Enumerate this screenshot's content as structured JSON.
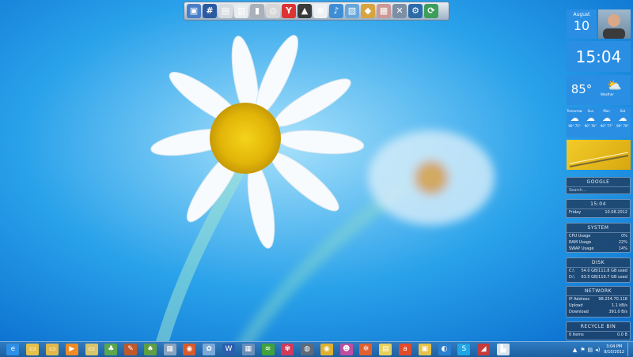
{
  "dock": {
    "items": [
      {
        "icon": "monitor-icon",
        "color": "#4a7ec7",
        "glyph": "▣"
      },
      {
        "icon": "network-icon",
        "color": "#2a5aa0",
        "glyph": "#"
      },
      {
        "icon": "documents-icon",
        "color": "#d7dbe0",
        "glyph": "▤"
      },
      {
        "icon": "pages-icon",
        "color": "#e8ecef",
        "glyph": "▥"
      },
      {
        "icon": "drive-icon",
        "color": "#a9b0b8",
        "glyph": "▮"
      },
      {
        "icon": "chrome-icon",
        "color": "#d6d6d6",
        "glyph": "◎"
      },
      {
        "icon": "youtube-icon",
        "color": "#d33",
        "glyph": "Y"
      },
      {
        "icon": "hat-icon",
        "color": "#3a3a3a",
        "glyph": "▲"
      },
      {
        "icon": "notepad-icon",
        "color": "#eef1f4",
        "glyph": "≡"
      },
      {
        "icon": "music-icon",
        "color": "#3e8ed6",
        "glyph": "♪"
      },
      {
        "icon": "photo-icon",
        "color": "#6aa7d9",
        "glyph": "▧"
      },
      {
        "icon": "package-icon",
        "color": "#d7a441",
        "glyph": "◆"
      },
      {
        "icon": "archive-icon",
        "color": "#c99",
        "glyph": "▦"
      },
      {
        "icon": "tools-icon",
        "color": "#7d8fa3",
        "glyph": "✕"
      },
      {
        "icon": "settings-icon",
        "color": "#2c6aa8",
        "glyph": "⚙"
      },
      {
        "icon": "sync-icon",
        "color": "#3c9e5a",
        "glyph": "⟳"
      }
    ]
  },
  "calendar": {
    "month": "August",
    "day": "10"
  },
  "clock_tile": {
    "time": "15:04"
  },
  "weather": {
    "temp": "85°",
    "label": "Weather"
  },
  "forecast": [
    {
      "day": "Tomorrow",
      "range": "90° 75°"
    },
    {
      "day": "Sun",
      "range": "90° 76°"
    },
    {
      "day": "Mon",
      "range": "90° 77°"
    },
    {
      "day": "Sat",
      "range": "90° 79°"
    }
  ],
  "google": {
    "title": "GOOGLE",
    "placeholder": "Search..."
  },
  "clock_panel": {
    "time": "15:04",
    "weekday": "Friday",
    "date": "10.08.2012"
  },
  "system": {
    "title": "SYSTEM",
    "rows": [
      {
        "label": "CPU Usage",
        "value": "0%"
      },
      {
        "label": "RAM Usage",
        "value": "22%"
      },
      {
        "label": "SWAP Usage",
        "value": "14%"
      }
    ]
  },
  "disk": {
    "title": "DISK",
    "rows": [
      {
        "label": "C:\\",
        "value": "54.0 GB/111.8 GB used"
      },
      {
        "label": "D:\\",
        "value": "63.5 GB/119.7 GB used"
      }
    ]
  },
  "network": {
    "title": "NETWORK",
    "rows": [
      {
        "label": "IP Address",
        "value": "98.254.70.118"
      },
      {
        "label": "Upload",
        "value": "1.1 kB/s"
      },
      {
        "label": "Download",
        "value": "391.0 B/s"
      }
    ]
  },
  "recycle": {
    "title": "RECYCLE BIN",
    "items": "0 items",
    "size": "0.0 B"
  },
  "taskbar": {
    "items": [
      {
        "icon": "internet-explorer-icon",
        "color": "#2f8fe6",
        "glyph": "e"
      },
      {
        "icon": "file-explorer-icon",
        "color": "#e5c04a",
        "glyph": "▭"
      },
      {
        "icon": "folder-icon",
        "color": "#e2b84a",
        "glyph": "▭"
      },
      {
        "icon": "media-player-icon",
        "color": "#f08a24",
        "glyph": "▶"
      },
      {
        "icon": "folder-2-icon",
        "color": "#d8c46a",
        "glyph": "▭"
      },
      {
        "icon": "game-icon",
        "color": "#5aa64f",
        "glyph": "♣"
      },
      {
        "icon": "brush-icon",
        "color": "#c0582a",
        "glyph": "✎"
      },
      {
        "icon": "tree-icon",
        "color": "#5e9f44",
        "glyph": "♠"
      },
      {
        "icon": "calculator-icon",
        "color": "#8aa3bf",
        "glyph": "▦"
      },
      {
        "icon": "photos-icon",
        "color": "#d95a2b",
        "glyph": "◉"
      },
      {
        "icon": "paint-icon",
        "color": "#7aa8d8",
        "glyph": "✿"
      },
      {
        "icon": "word-icon",
        "color": "#2b5fad",
        "glyph": "W"
      },
      {
        "icon": "grid-icon",
        "color": "#6a8fb8",
        "glyph": "▦"
      },
      {
        "icon": "spotify-icon",
        "color": "#3ea33b",
        "glyph": "≋"
      },
      {
        "icon": "flower-icon",
        "color": "#d23a5a",
        "glyph": "✾"
      },
      {
        "icon": "steam-icon",
        "color": "#5e6a78",
        "glyph": "◍"
      },
      {
        "icon": "chrome-task-icon",
        "color": "#e0b030",
        "glyph": "◉"
      },
      {
        "icon": "character-icon",
        "color": "#c04ea0",
        "glyph": "☻"
      },
      {
        "icon": "butterfly-icon",
        "color": "#e06030",
        "glyph": "✲"
      },
      {
        "icon": "notes-icon",
        "color": "#e8d05a",
        "glyph": "▤"
      },
      {
        "icon": "app-a-icon",
        "color": "#e24a2a",
        "glyph": "a"
      },
      {
        "icon": "photo-viewer-icon",
        "color": "#e7c14a",
        "glyph": "▣"
      },
      {
        "icon": "teamviewer-icon",
        "color": "#2a7fd0",
        "glyph": "◐"
      },
      {
        "icon": "skype-icon",
        "color": "#1ea6e6",
        "glyph": "S"
      },
      {
        "icon": "chat-icon",
        "color": "#c73a3a",
        "glyph": "◢"
      },
      {
        "icon": "store-icon",
        "color": "#d7e3ef",
        "glyph": "▙"
      }
    ],
    "clock_time": "3:04 PM",
    "clock_date": "8/10/2012"
  }
}
